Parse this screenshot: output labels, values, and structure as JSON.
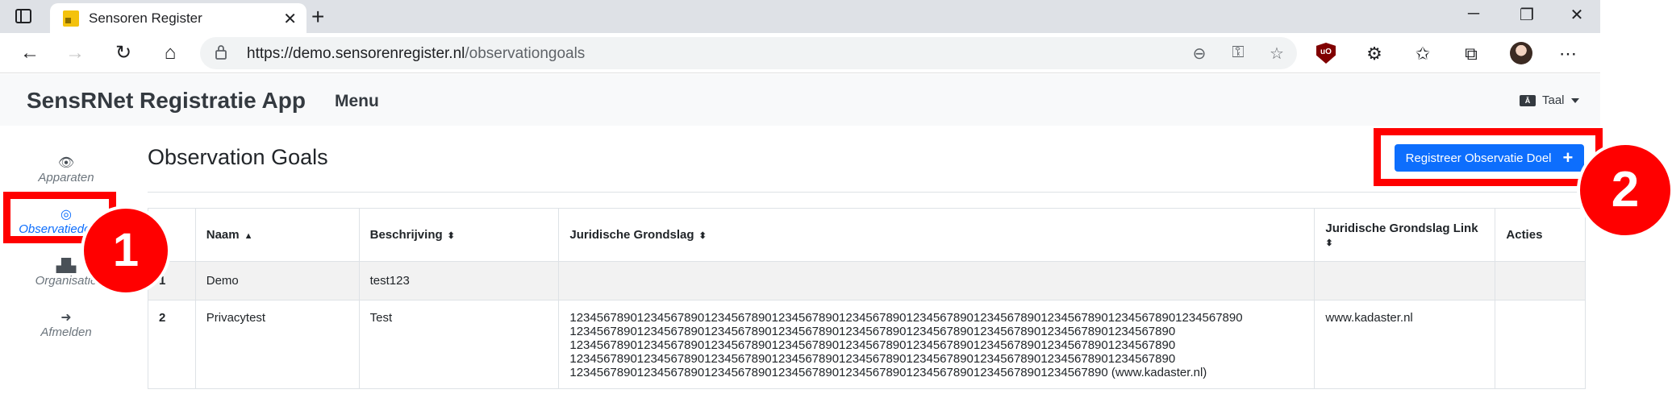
{
  "browser": {
    "tab_title": "Sensoren Register",
    "url_host": "https://demo.sensorenregister.nl",
    "url_path": "/observationgoals",
    "icons": [
      "sidebar-toggle-icon",
      "favicon",
      "close-icon",
      "plus-icon",
      "back-icon",
      "forward-icon",
      "reload-icon",
      "home-icon",
      "lock-icon",
      "zoom-out-icon",
      "account-key-icon",
      "favorite-add-icon",
      "ublock-icon",
      "extensions-icon",
      "favorites-icon",
      "collections-icon",
      "avatar",
      "more-icon",
      "minimize-icon",
      "restore-icon",
      "close-window-icon"
    ]
  },
  "app": {
    "brand": "SensRNet Registratie App",
    "menu_label": "Menu",
    "lang_icon_text": "Ā",
    "lang_label": "Taal"
  },
  "sidebar": {
    "items": [
      {
        "label": "Apparaten",
        "icon": "eye-icon",
        "active": false
      },
      {
        "label": "Observatiedoelen",
        "icon": "target-icon",
        "active": true
      },
      {
        "label": "Organisatie",
        "icon": "building-icon",
        "active": false
      },
      {
        "label": "Afmelden",
        "icon": "sign-out-icon",
        "active": false
      }
    ]
  },
  "page": {
    "title": "Observation Goals",
    "register_button": "Registreer Observatie Doel"
  },
  "table": {
    "columns": [
      "",
      "Naam",
      "Beschrijving",
      "Juridische Grondslag",
      "Juridische Grondslag Link",
      "Acties"
    ],
    "sort_indicators": {
      "Naam": "▲",
      "Beschrijving": "⬍",
      "Juridische Grondslag": "⬍",
      "Juridische Grondslag Link": "⬍"
    },
    "rows": [
      {
        "id": "1",
        "naam": "Demo",
        "beschrijving": "test123",
        "grondslag": "",
        "link": "",
        "acties": ""
      },
      {
        "id": "2",
        "naam": "Privacytest",
        "beschrijving": "Test",
        "grondslag_lines": [
          "1234567890123456789012345678901234567890123456789012345678901234567890123456789012345678901234567890",
          "123456789012345678901234567890123456789012345678901234567890123456789012345678901234567890",
          "123456789012345678901234567890123456789012345678901234567890123456789012345678901234567890",
          "123456789012345678901234567890123456789012345678901234567890123456789012345678901234567890",
          "12345678901234567890123456789012345678901234567890123456789012345678901234567890 (www.kadaster.nl)"
        ],
        "link": "www.kadaster.nl",
        "acties": ""
      }
    ]
  },
  "annotations": {
    "callout_1": "1",
    "callout_2": "2",
    "highlight_color": "#ff0000"
  },
  "colors": {
    "primary": "#0d6efd",
    "navbar_bg": "#f8f9fa",
    "annotation": "#ff0000"
  }
}
